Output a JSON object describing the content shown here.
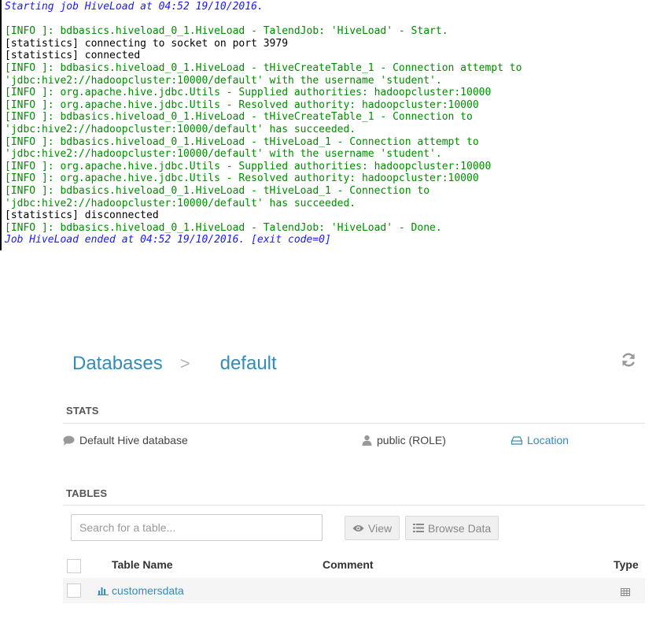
{
  "console": {
    "lines": [
      {
        "text": "Starting job HiveLoad at 04:52 19/10/2016.",
        "color": "blue"
      },
      {
        "text": "",
        "color": "black"
      },
      {
        "text": "[INFO ]: bdbasics.hiveload_0_1.HiveLoad - TalendJob: 'HiveLoad' - Start.",
        "color": "green"
      },
      {
        "text": "[statistics] connecting to socket on port 3979",
        "color": "black"
      },
      {
        "text": "[statistics] connected",
        "color": "black"
      },
      {
        "text": "[INFO ]: bdbasics.hiveload_0_1.HiveLoad - tHiveCreateTable_1 - Connection attempt to",
        "color": "green"
      },
      {
        "text": "'jdbc:hive2://hadoopcluster:10000/default' with the username 'student'.",
        "color": "green"
      },
      {
        "text": "[INFO ]: org.apache.hive.jdbc.Utils - Supplied authorities: hadoopcluster:10000",
        "color": "green"
      },
      {
        "text": "[INFO ]: org.apache.hive.jdbc.Utils - Resolved authority: hadoopcluster:10000",
        "color": "green"
      },
      {
        "text": "[INFO ]: bdbasics.hiveload_0_1.HiveLoad - tHiveCreateTable_1 - Connection to",
        "color": "green"
      },
      {
        "text": "'jdbc:hive2://hadoopcluster:10000/default' has succeeded.",
        "color": "green"
      },
      {
        "text": "[INFO ]: bdbasics.hiveload_0_1.HiveLoad - tHiveLoad_1 - Connection attempt to",
        "color": "green"
      },
      {
        "text": "'jdbc:hive2://hadoopcluster:10000/default' with the username 'student'.",
        "color": "green"
      },
      {
        "text": "[INFO ]: org.apache.hive.jdbc.Utils - Supplied authorities: hadoopcluster:10000",
        "color": "green"
      },
      {
        "text": "[INFO ]: org.apache.hive.jdbc.Utils - Resolved authority: hadoopcluster:10000",
        "color": "green"
      },
      {
        "text": "[INFO ]: bdbasics.hiveload_0_1.HiveLoad - tHiveLoad_1 - Connection to",
        "color": "green"
      },
      {
        "text": "'jdbc:hive2://hadoopcluster:10000/default' has succeeded.",
        "color": "green"
      },
      {
        "text": "[statistics] disconnected",
        "color": "black"
      },
      {
        "text": "[INFO ]: bdbasics.hiveload_0_1.HiveLoad - TalendJob: 'HiveLoad' - Done.",
        "color": "green"
      },
      {
        "text": "Job HiveLoad ended at 04:52 19/10/2016. [exit code=0]",
        "color": "blue"
      }
    ]
  },
  "breadcrumb": {
    "root": "Databases",
    "separator": ">",
    "current": "default"
  },
  "stats": {
    "title": "STATS",
    "description": "Default Hive database",
    "owner": "public (ROLE)",
    "location_label": "Location"
  },
  "tables": {
    "title": "TABLES",
    "search_placeholder": "Search for a table...",
    "view_label": "View",
    "browse_label": "Browse Data",
    "columns": {
      "name": "Table Name",
      "comment": "Comment",
      "type": "Type"
    },
    "rows": [
      {
        "name": "customersdata",
        "comment": ""
      }
    ]
  },
  "icons": {
    "refresh": "refresh-icon",
    "comment": "comment-icon",
    "user": "user-icon",
    "location": "hdd-icon",
    "view": "eye-icon",
    "browse": "list-icon",
    "chart": "bar-chart-icon",
    "type": "table-icon"
  },
  "colors": {
    "console_blue": "#1a1aff",
    "console_green": "#008a00",
    "link_blue": "#338bb8",
    "row_bg": "#f5f5f5"
  }
}
